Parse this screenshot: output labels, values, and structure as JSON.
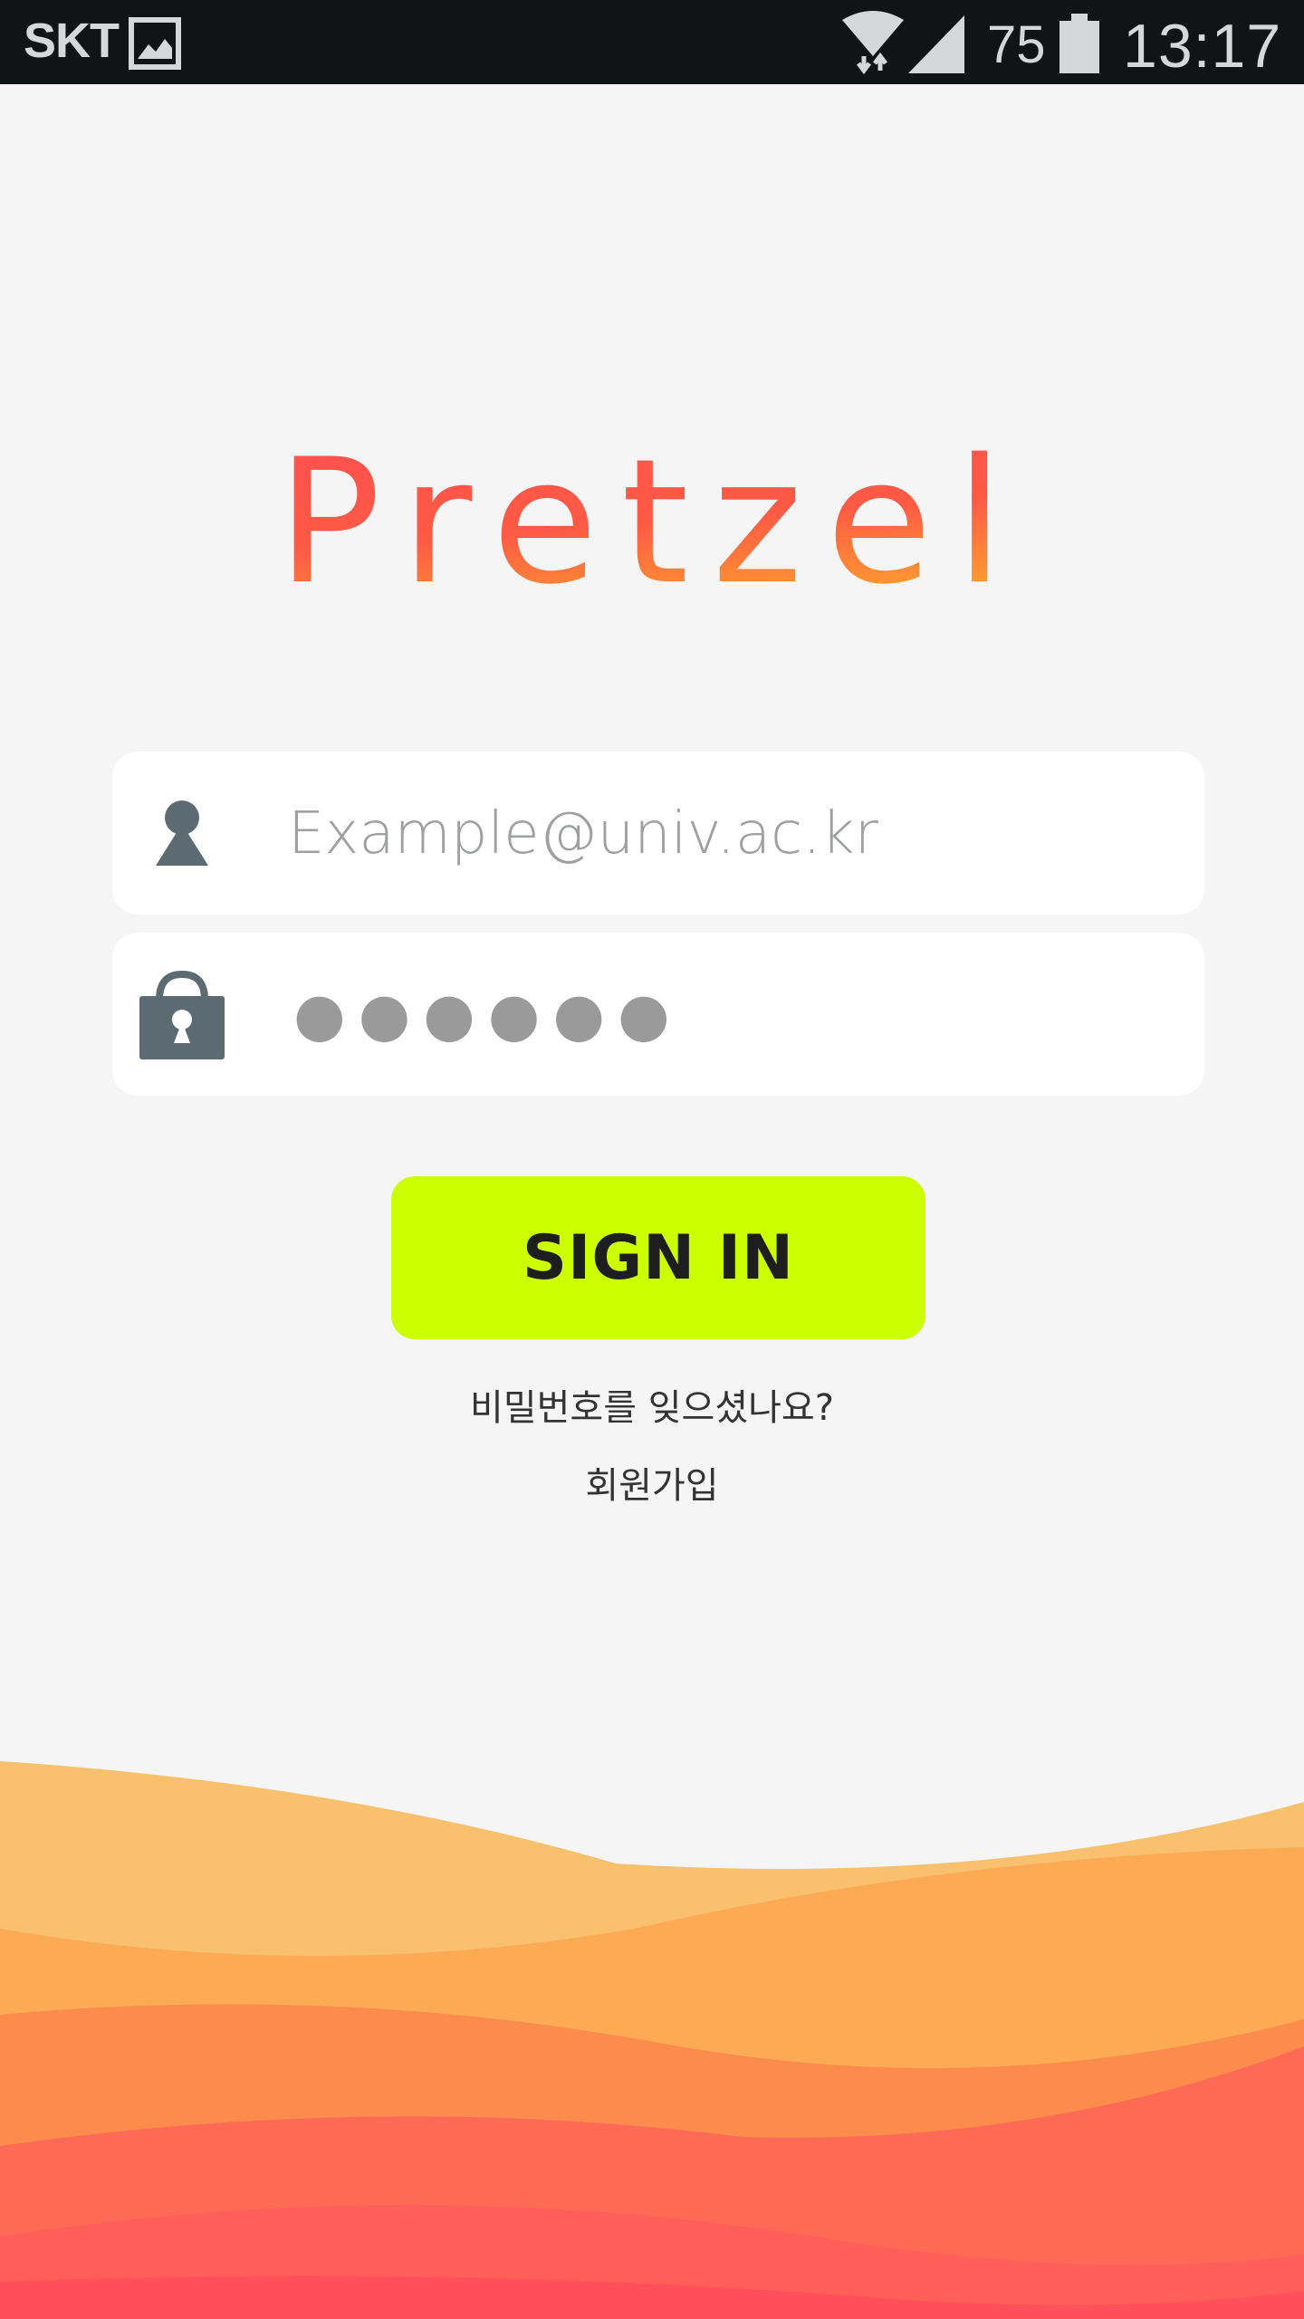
{
  "status_bar": {
    "carrier": "SKT",
    "battery_level": "75",
    "time": "13:17",
    "icons": [
      "gallery-icon",
      "wifi-data-icon",
      "signal-icon",
      "battery-icon"
    ]
  },
  "logo": {
    "text": "Pretzel",
    "gradient_start": "#ff4f4f",
    "gradient_end": "#ff9a30"
  },
  "email_field": {
    "placeholder": "Example@univ.ac.kr",
    "value": "",
    "icon": "user-icon"
  },
  "password_field": {
    "masked_value": "●●●●●●",
    "icon": "lock-icon"
  },
  "sign_in_button": {
    "label": "SIGN IN",
    "color": "#ccff00"
  },
  "links": {
    "forgot_password": "비밀번호를 잊으셨나요?",
    "sign_up": "회원가입"
  },
  "colors": {
    "background": "#f4f5f4",
    "icon": "#5c6b72",
    "wave_colors": [
      "#f9c06e",
      "#fdaa55",
      "#fc8b4c",
      "#ff6a57",
      "#ff4f5a"
    ]
  }
}
